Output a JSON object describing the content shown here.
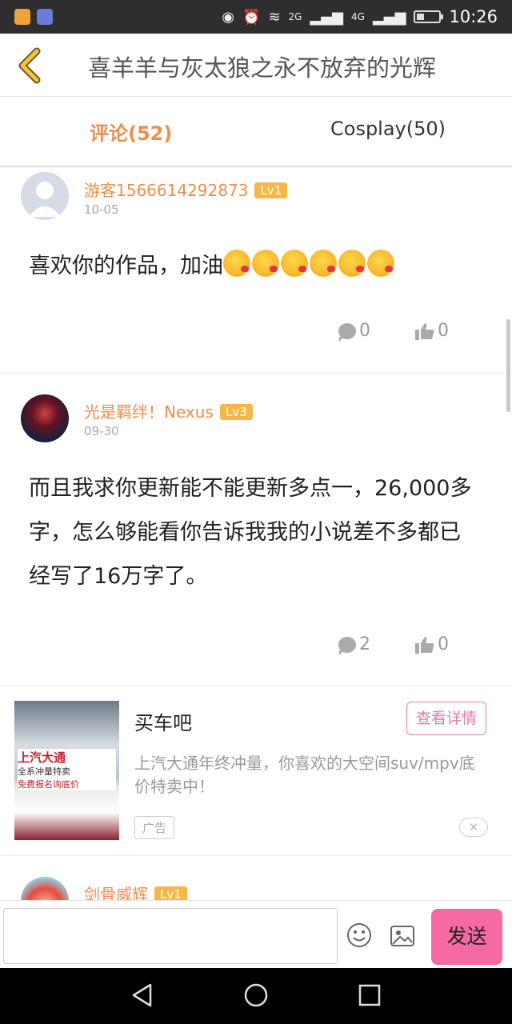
{
  "status_bar": {
    "time": "10:26",
    "net1": "2G",
    "net2": "4G"
  },
  "header": {
    "title": "喜羊羊与灰太狼之永不放弃的光辉"
  },
  "tabs": [
    {
      "label": "评论(52)",
      "active": true
    },
    {
      "label": "Cosplay(50)",
      "active": false
    }
  ],
  "comments": [
    {
      "username": "游客1566614292873",
      "level": "Lv1",
      "date": "10-05",
      "text": "喜欢你的作品，加油",
      "emoji_count": 6,
      "replies": "0",
      "likes": "0"
    },
    {
      "username": "光是羁绊！Nexus",
      "level": "Lv3",
      "date": "09-30",
      "text": "而且我求你更新能不能更新多点一，26,000多字，怎么够能看你告诉我我的小说差不多都已经写了16万字了。",
      "replies": "2",
      "likes": "0"
    },
    {
      "username": "剑骨威辉",
      "level": "Lv1"
    }
  ],
  "ad": {
    "title": "买车吧",
    "button": "查看详情",
    "description": "上汽大通年终冲量，你喜欢的大空间suv/mpv底价特卖中！",
    "tag": "广告",
    "close": "✕",
    "image_text_1": "上汽大通",
    "image_text_2": "全系冲量特卖",
    "image_text_3": "免费报名询底价"
  },
  "input_bar": {
    "value": "",
    "send_label": "发送"
  },
  "colors": {
    "accent": "#ef8d4c",
    "level_badge": "#f5b848",
    "send_button": "#f769a2",
    "ad_button": "#e07eaf"
  }
}
